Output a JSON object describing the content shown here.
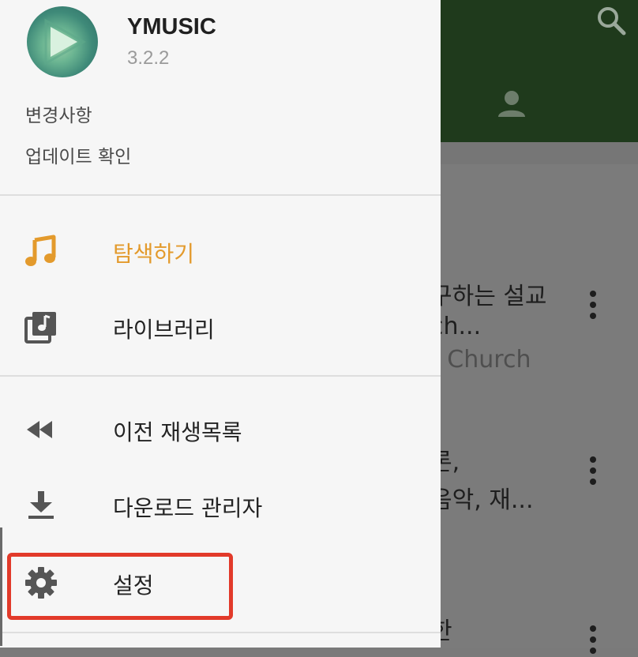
{
  "app": {
    "name": "YMUSIC",
    "version": "3.2.2"
  },
  "header_links": [
    {
      "label": "변경사항"
    },
    {
      "label": "업데이트 확인"
    }
  ],
  "nav": {
    "explore": {
      "label": "탐색하기",
      "icon": "music-note-icon",
      "active": true
    },
    "library": {
      "label": "라이브러리",
      "icon": "library-music-icon"
    },
    "prev_playlist": {
      "label": "이전 재생목록",
      "icon": "rewind-icon"
    },
    "download_manager": {
      "label": "다운로드 관리자",
      "icon": "download-icon"
    },
    "settings": {
      "label": "설정",
      "icon": "gear-icon"
    }
  },
  "background": {
    "items": [
      {
        "line1": "구하는 설교",
        "line2": "ch...",
        "line3": "t Church"
      },
      {
        "line1": "론,",
        "line2": " 음악, 재..."
      },
      {
        "line1": "한"
      }
    ]
  },
  "colors": {
    "accent": "#e39a2c",
    "toolbar": "#1f3a1c",
    "highlight": "#e23a2a"
  }
}
